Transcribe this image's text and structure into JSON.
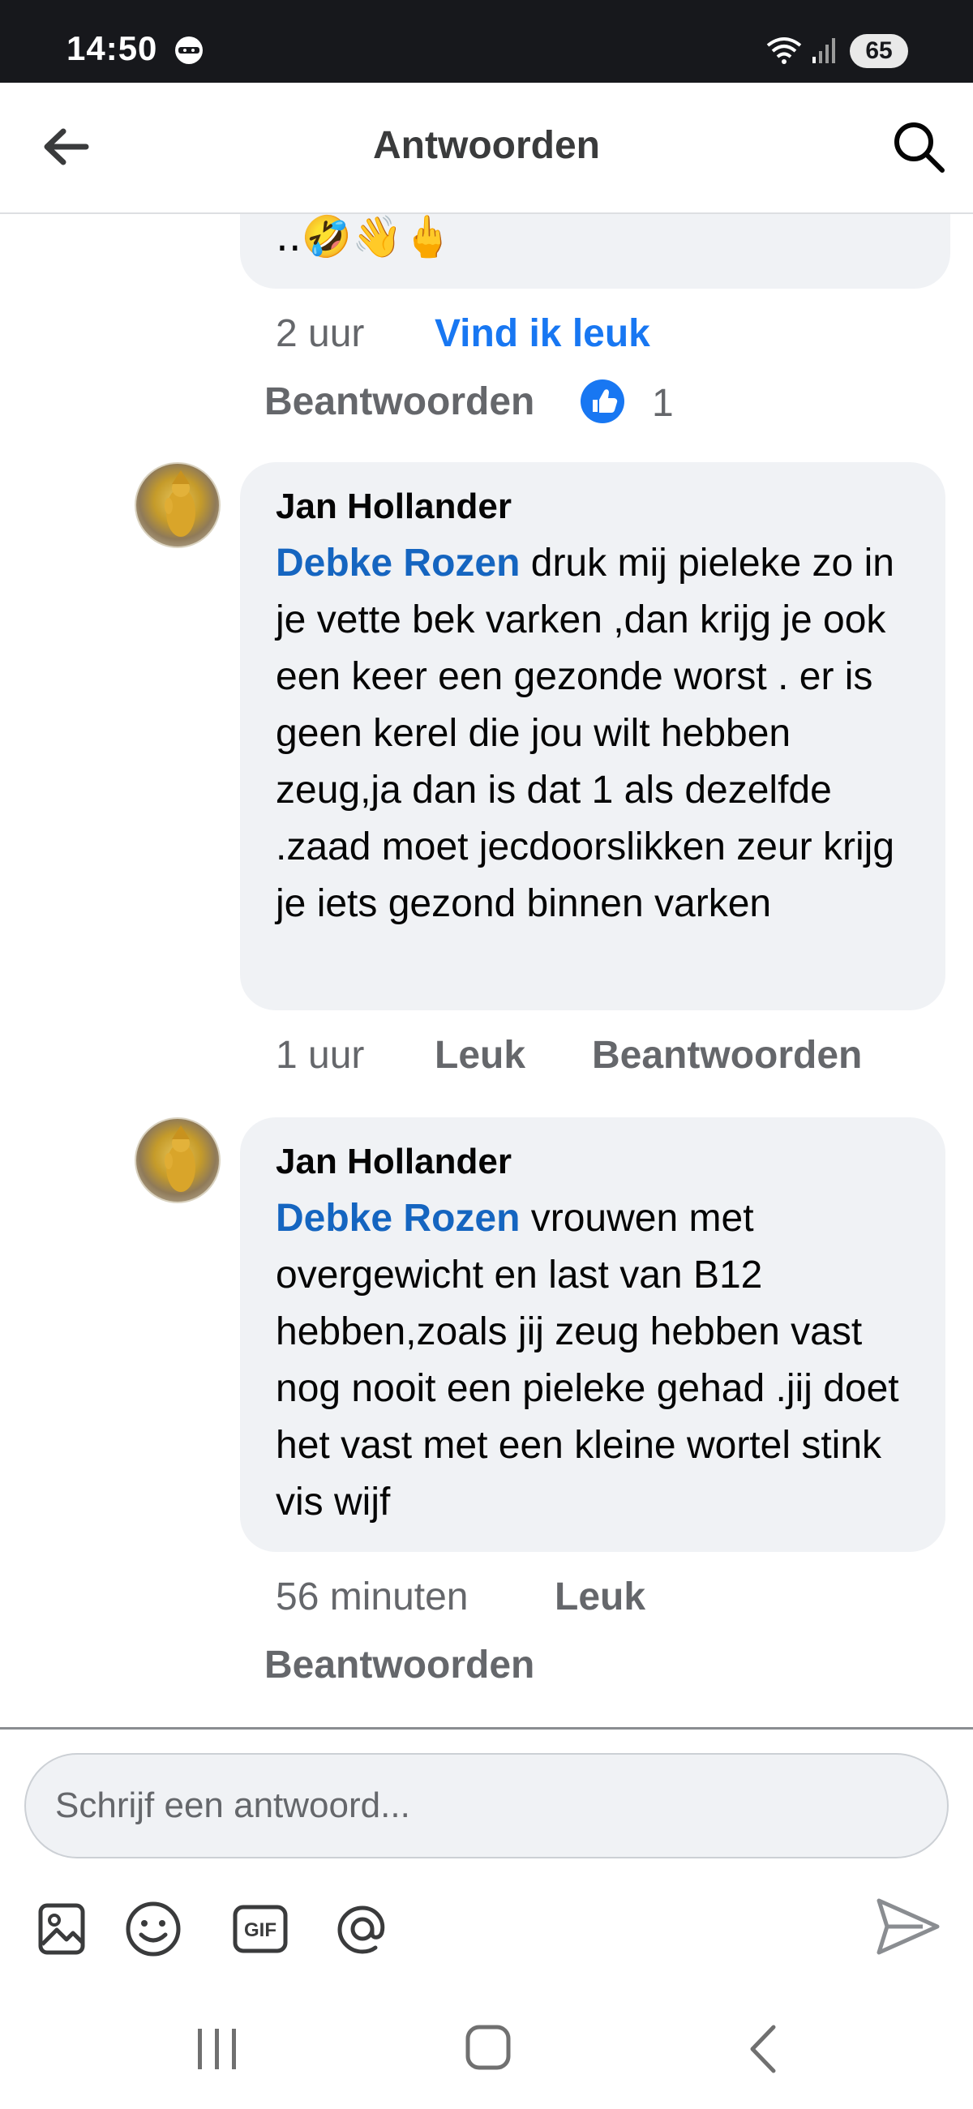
{
  "status_bar": {
    "time": "14:50",
    "battery": "65",
    "icons": [
      "ninja-icon",
      "wifi-icon",
      "signal-icon",
      "battery-icon"
    ]
  },
  "header": {
    "title": "Antwoorden",
    "back_icon": "arrow-left-icon",
    "search_icon": "search-icon"
  },
  "previous_comment": {
    "text_tail": "..",
    "emojis": [
      "🤣",
      "👋",
      "🖕"
    ],
    "time": "2 uur",
    "like_label": "Vind ik leuk",
    "reply_label": "Beantwoorden",
    "reaction_count": "1"
  },
  "comments": [
    {
      "author": "Jan Hollander",
      "mention": "Debke Rozen",
      "text": " druk mij pieleke zo in je vette bek varken ,dan krijg je ook een keer een gezonde worst . er is geen kerel die jou wilt hebben zeug,ja dan is dat 1 als dezelfde .zaad moet jecdoorslikken zeur krijg je iets gezond binnen varken",
      "time": "1 uur",
      "like_label": "Leuk",
      "reply_label": "Beantwoorden"
    },
    {
      "author": "Jan Hollander",
      "mention": "Debke Rozen",
      "text": " vrouwen met overgewicht en last van B12 hebben,zoals jij zeug hebben vast nog nooit een pieleke gehad .jij doet het vast met een kleine wortel stink vis wijf",
      "time": "56 minuten",
      "like_label": "Leuk",
      "reply_label": "Beantwoorden"
    }
  ],
  "composer": {
    "placeholder": "Schrijf een antwoord...",
    "tools": [
      "image-icon",
      "emoji-icon",
      "gif-icon",
      "mention-icon"
    ],
    "send_icon": "send-icon"
  },
  "colors": {
    "accent": "#1877f2",
    "mention": "#1565c0",
    "bubble": "#f0f2f5",
    "meta": "#65676b",
    "status_bar": "#17181c"
  }
}
